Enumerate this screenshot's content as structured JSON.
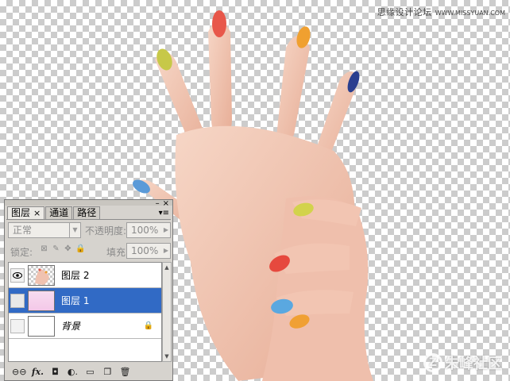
{
  "watermark": {
    "top_text": "思缘设计论坛",
    "top_url": "WWW.MISSYUAN.COM",
    "bottom_text": "朱峰社区",
    "bottom_sub": "zhufengs.com"
  },
  "layers_panel": {
    "tabs": [
      {
        "label": "图层",
        "close": "×"
      },
      {
        "label": "通道"
      },
      {
        "label": "路径"
      }
    ],
    "window_controls": {
      "minimize": "–",
      "close": "×"
    },
    "menu_glyph": "▾≡",
    "blend_mode": "正常",
    "opacity_label": "不透明度:",
    "opacity_value": "100%",
    "lock_label": "锁定:",
    "fill_label": "填充:",
    "fill_value": "100%",
    "layers": [
      {
        "name": "图层 2",
        "visible": true,
        "selected": false,
        "thumb": "checker-hand"
      },
      {
        "name": "图层 1",
        "visible": false,
        "selected": true,
        "thumb": "pink"
      },
      {
        "name": "背景",
        "visible": false,
        "selected": false,
        "thumb": "white",
        "locked": true
      }
    ],
    "bottom_buttons": [
      {
        "name": "link-layers-icon",
        "glyph": "⊖⊖"
      },
      {
        "name": "layer-style-icon",
        "glyph": "fx."
      },
      {
        "name": "layer-mask-icon",
        "glyph": "◘"
      },
      {
        "name": "adjustment-layer-icon",
        "glyph": "◐."
      },
      {
        "name": "new-group-icon",
        "glyph": "▭"
      },
      {
        "name": "new-layer-icon",
        "glyph": "❐"
      },
      {
        "name": "delete-layer-icon",
        "glyph": "🗑"
      }
    ]
  },
  "colors": {
    "selection": "#316ac5",
    "panel_bg": "#d6d3ce",
    "skin": "#f2c8b6"
  }
}
